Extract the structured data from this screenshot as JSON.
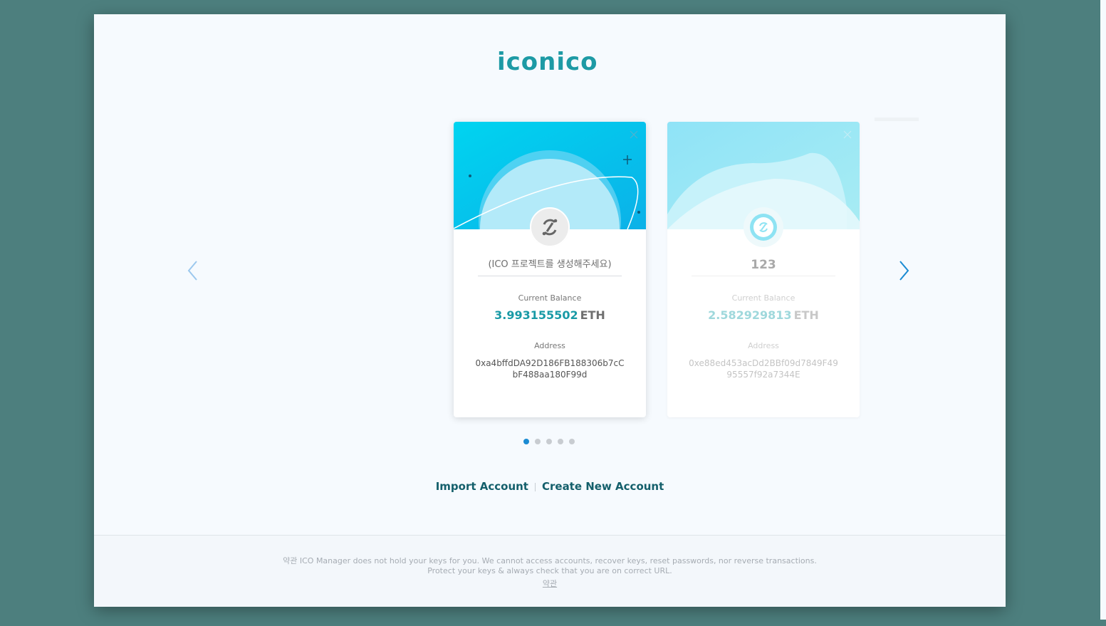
{
  "brand": {
    "logo_text": "iconico",
    "accent": "#1d9aa5"
  },
  "navigation": {
    "prev_icon": "chevron-left-icon",
    "next_icon": "chevron-right-icon"
  },
  "cards": [
    {
      "name": "(ICO 프로젝트를 생성해주세요)",
      "balance_label": "Current Balance",
      "balance": "3.993155502",
      "unit": "ETH",
      "address_label": "Address",
      "address": "0xa4bffdDA92D186FB188306b7cCbF488aa180F99d",
      "state": "active"
    },
    {
      "name": "123",
      "balance_label": "Current Balance",
      "balance": "2.582929813",
      "unit": "ETH",
      "address_label": "Address",
      "address": "0xe88ed453acDd2BBf09d7849F4995557f92a7344E",
      "state": "inactive"
    }
  ],
  "pagination": {
    "count": 5,
    "current": 1
  },
  "actions": {
    "import_label": "Import Account",
    "create_label": "Create New Account"
  },
  "footer": {
    "line1": "약관 ICO Manager does not hold your keys for you. We cannot access accounts, recover keys, reset passwords, nor reverse transactions.",
    "line2": "Protect your keys & always check that you are on correct URL.",
    "terms_link": "약관"
  }
}
